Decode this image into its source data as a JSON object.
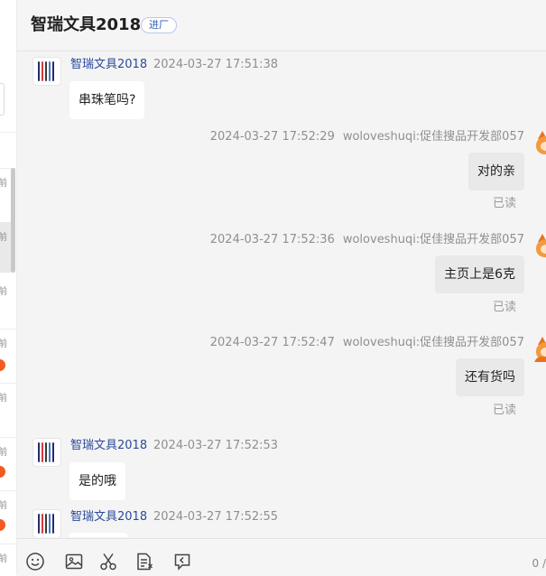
{
  "left_list": {
    "times": [
      "前",
      "前",
      "前",
      "前",
      "前",
      "前",
      "前",
      "前"
    ]
  },
  "chat": {
    "title": "智瑞文具2018",
    "tag": "进厂",
    "messages": [
      {
        "side": "left",
        "sender": "智瑞文具2018",
        "time": "2024-03-27 17:51:38",
        "text": "串珠笔吗?"
      },
      {
        "side": "right",
        "time": "2024-03-27 17:52:29",
        "sender": "woloveshuqi:促佳搜品开发部057",
        "text": "对的亲",
        "status": "已读"
      },
      {
        "side": "right",
        "time": "2024-03-27 17:52:36",
        "sender": "woloveshuqi:促佳搜品开发部057",
        "text": "主页上是6克",
        "status": "已读"
      },
      {
        "side": "right",
        "time": "2024-03-27 17:52:47",
        "sender": "woloveshuqi:促佳搜品开发部057",
        "text": "还有货吗",
        "status": "已读"
      },
      {
        "side": "left",
        "sender": "智瑞文具2018",
        "time": "2024-03-27 17:52:53",
        "text": "是的哦"
      },
      {
        "side": "left",
        "sender": "智瑞文具2018",
        "time": "2024-03-27 17:52:55",
        "text": ""
      }
    ]
  },
  "toolbar": {
    "icons": [
      "emoji-icon",
      "image-icon",
      "scissors-icon",
      "document-icon",
      "history-icon"
    ],
    "char_count": "0 /"
  },
  "colors": {
    "accent": "#2b4a9b",
    "chat_bg": "#f4f4f4",
    "bubble_right": "#e9e9e9",
    "unread": "#f25b1f"
  }
}
